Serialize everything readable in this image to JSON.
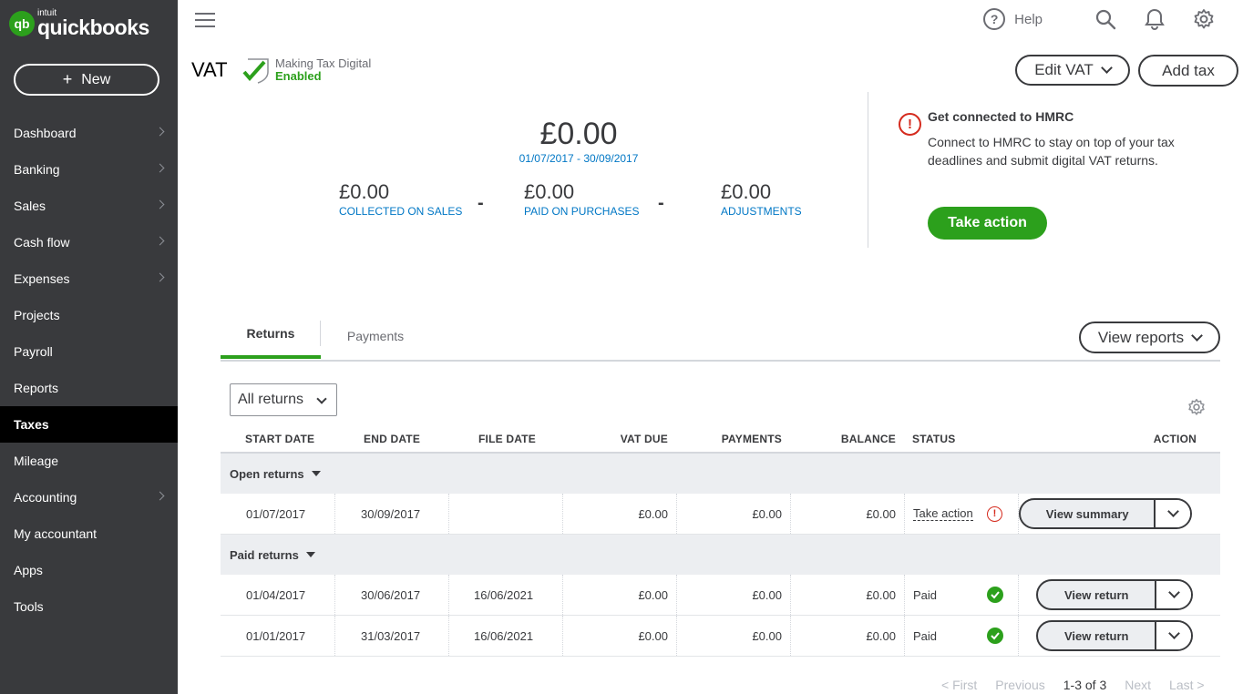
{
  "app": {
    "brand_small": "intuit",
    "brand": "quickbooks",
    "brand_mark": "qb"
  },
  "sidebar": {
    "new_label": "New",
    "items": [
      {
        "label": "Dashboard",
        "chevron": true
      },
      {
        "label": "Banking",
        "chevron": true
      },
      {
        "label": "Sales",
        "chevron": true
      },
      {
        "label": "Cash flow",
        "chevron": true
      },
      {
        "label": "Expenses",
        "chevron": true
      },
      {
        "label": "Projects",
        "chevron": false
      },
      {
        "label": "Payroll",
        "chevron": false
      },
      {
        "label": "Reports",
        "chevron": false
      },
      {
        "label": "Taxes",
        "chevron": false,
        "active": true
      },
      {
        "label": "Mileage",
        "chevron": false
      },
      {
        "label": "Accounting",
        "chevron": true
      },
      {
        "label": "My accountant",
        "chevron": false
      },
      {
        "label": "Apps",
        "chevron": false
      },
      {
        "label": "Tools",
        "chevron": false
      }
    ]
  },
  "topbar": {
    "help_label": "Help",
    "help_glyph": "?"
  },
  "page": {
    "title": "VAT",
    "mtd_line1": "Making Tax Digital",
    "mtd_line2": "Enabled",
    "edit_vat_label": "Edit VAT",
    "add_tax_label": "Add tax"
  },
  "summary": {
    "total": "£0.00",
    "range": "01/07/2017 - 30/09/2017",
    "collected_amount": "£0.00",
    "collected_label": "COLLECTED ON SALES",
    "minus": "-",
    "paid_amount": "£0.00",
    "paid_label": "PAID ON PURCHASES",
    "adjust_amount": "£0.00",
    "adjust_label": "ADJUSTMENTS"
  },
  "hmrc": {
    "alert_glyph": "!",
    "title": "Get connected to HMRC",
    "body": "Connect to HMRC to stay on top of your tax deadlines and submit digital VAT returns.",
    "button_label": "Take action"
  },
  "tabs": {
    "returns": "Returns",
    "payments": "Payments",
    "view_reports": "View reports"
  },
  "filter": {
    "value": "All returns"
  },
  "table": {
    "headers": {
      "start": "START DATE",
      "end": "END DATE",
      "file": "FILE DATE",
      "vat_due": "VAT DUE",
      "payments": "PAYMENTS",
      "balance": "BALANCE",
      "status": "STATUS",
      "action": "ACTION"
    },
    "open_group": "Open returns",
    "paid_group": "Paid returns",
    "open_rows": [
      {
        "start": "01/07/2017",
        "end": "30/09/2017",
        "file": "",
        "vat_due": "£0.00",
        "payments": "£0.00",
        "balance": "£0.00",
        "status": "Take action",
        "action": "View summary"
      }
    ],
    "paid_rows": [
      {
        "start": "01/04/2017",
        "end": "30/06/2017",
        "file": "16/06/2021",
        "vat_due": "£0.00",
        "payments": "£0.00",
        "balance": "£0.00",
        "status": "Paid",
        "action": "View return"
      },
      {
        "start": "01/01/2017",
        "end": "31/03/2017",
        "file": "16/06/2021",
        "vat_due": "£0.00",
        "payments": "£0.00",
        "balance": "£0.00",
        "status": "Paid",
        "action": "View return"
      }
    ]
  },
  "pager": {
    "first": "< First",
    "previous": "Previous",
    "current": "1-3 of 3",
    "next": "Next",
    "last": "Last >"
  },
  "colors": {
    "green": "#2ca01c",
    "sidebar": "#393a3d",
    "link": "#0077c5",
    "alert": "#d52b1e"
  }
}
